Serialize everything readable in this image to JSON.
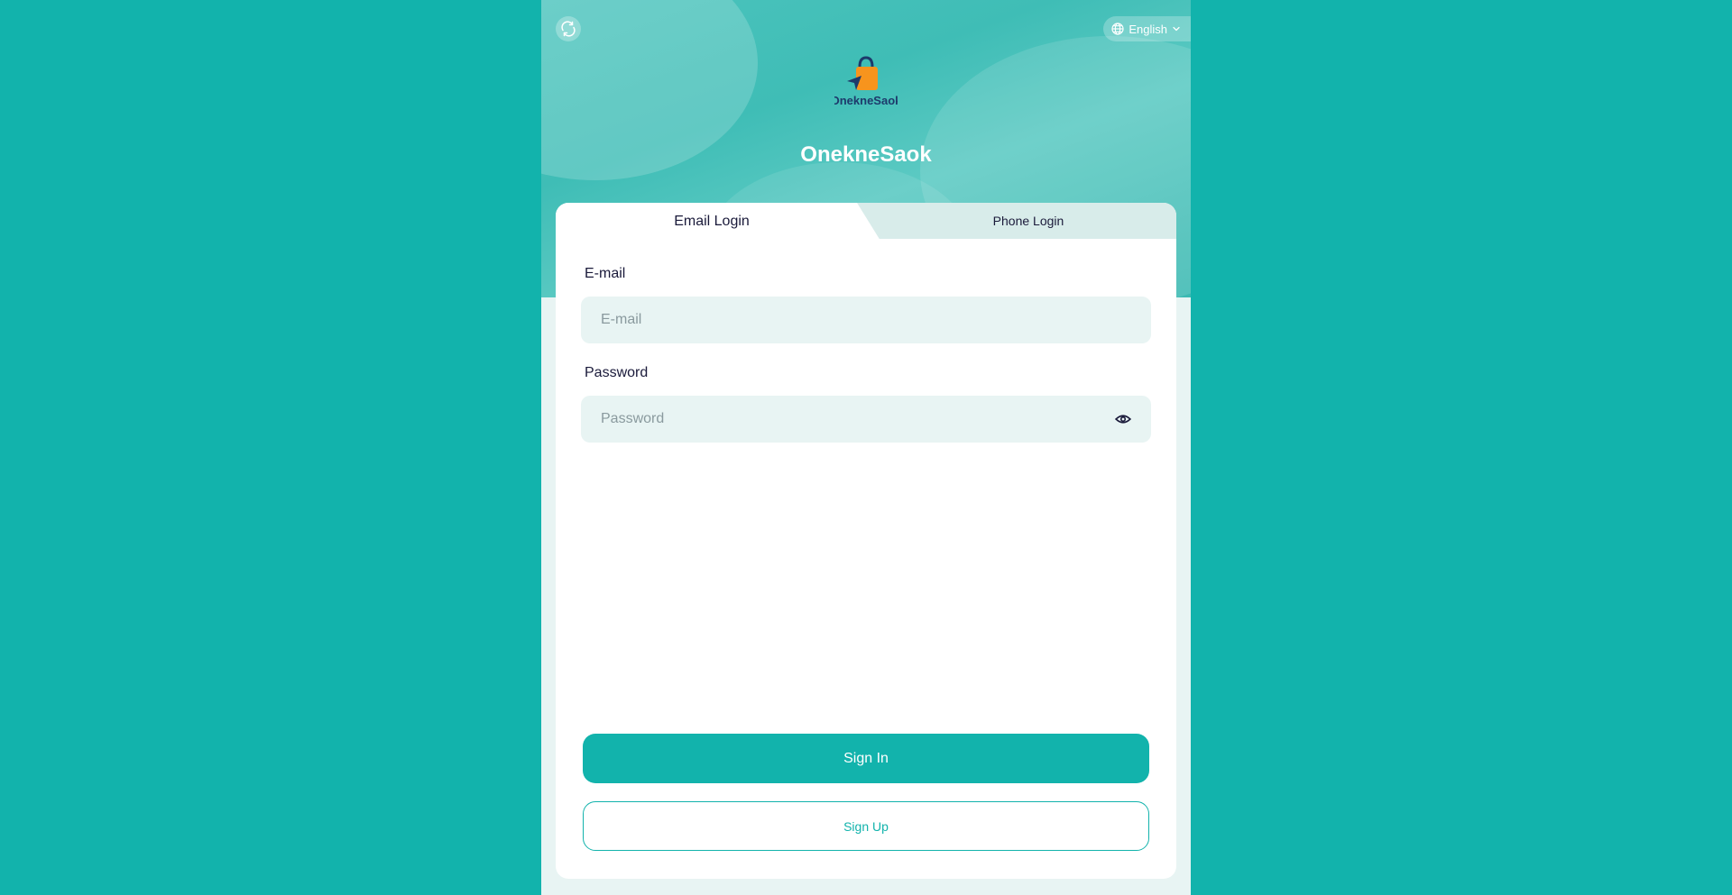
{
  "header": {
    "support_icon": "headset-refresh-icon",
    "language": {
      "icon": "globe-icon",
      "label": "English",
      "chevron_icon": "chevron-down-icon"
    },
    "brand_name": "OnekneSaok",
    "logo_text": "OnekneSaok"
  },
  "tabs": [
    {
      "label": "Email Login",
      "active": true
    },
    {
      "label": "Phone Login",
      "active": false
    }
  ],
  "form": {
    "email": {
      "label": "E-mail",
      "placeholder": "E-mail",
      "value": ""
    },
    "password": {
      "label": "Password",
      "placeholder": "Password",
      "value": "",
      "toggle_icon": "eye-icon"
    }
  },
  "actions": {
    "sign_in": "Sign In",
    "sign_up": "Sign Up"
  },
  "colors": {
    "primary": "#12b3ac",
    "input_bg": "#e8f4f3",
    "logo_orange": "#f7941d",
    "logo_navy": "#1d3a6b",
    "text_dark": "#1a1a3a"
  }
}
